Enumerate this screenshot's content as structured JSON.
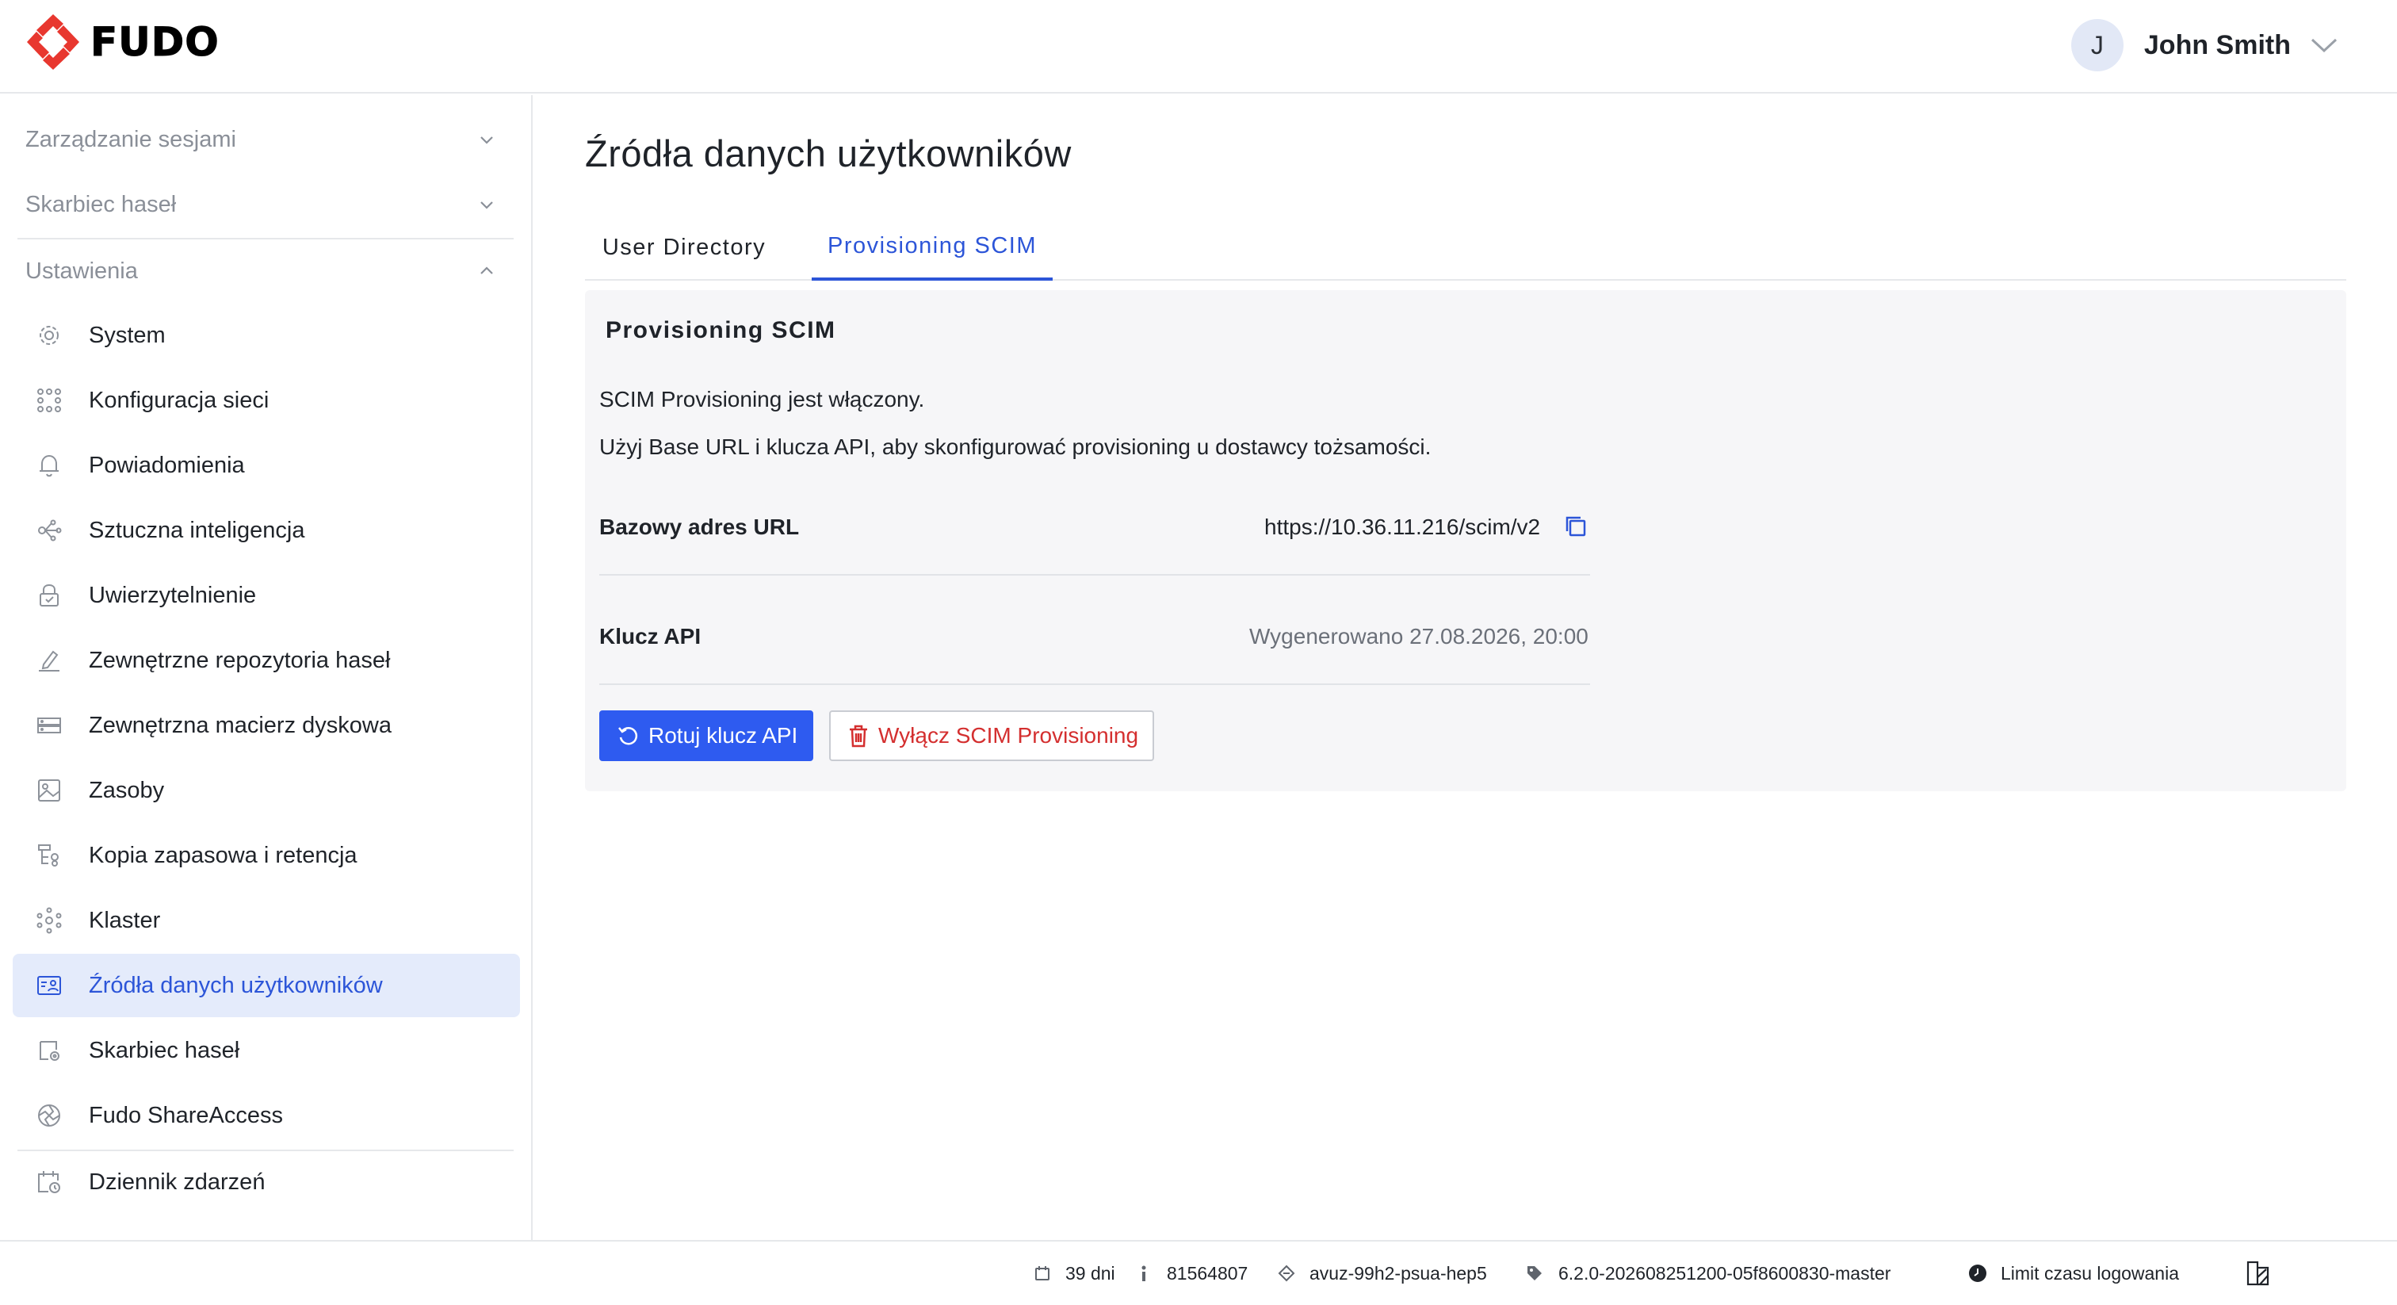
{
  "header": {
    "logo_text": "FUDO",
    "user": {
      "initial": "J",
      "name": "John Smith"
    }
  },
  "sidebar": {
    "sections": [
      {
        "label": "Zarządzanie sesjami",
        "expanded": false
      },
      {
        "label": "Skarbiec haseł",
        "expanded": false
      },
      {
        "label": "Ustawienia",
        "expanded": true
      }
    ],
    "items": [
      {
        "label": "System",
        "icon": "gear-icon"
      },
      {
        "label": "Konfiguracja sieci",
        "icon": "network-icon"
      },
      {
        "label": "Powiadomienia",
        "icon": "bell-icon"
      },
      {
        "label": "Sztuczna inteligencja",
        "icon": "ai-icon"
      },
      {
        "label": "Uwierzytelnienie",
        "icon": "lock-icon"
      },
      {
        "label": "Zewnętrzne repozytoria haseł",
        "icon": "pen-icon"
      },
      {
        "label": "Zewnętrzna macierz dyskowa",
        "icon": "storage-icon"
      },
      {
        "label": "Zasoby",
        "icon": "image-icon"
      },
      {
        "label": "Kopia zapasowa i retencja",
        "icon": "backup-icon"
      },
      {
        "label": "Klaster",
        "icon": "cluster-icon"
      },
      {
        "label": "Źródła danych użytkowników",
        "icon": "user-card-icon",
        "active": true
      },
      {
        "label": "Skarbiec haseł",
        "icon": "vault-icon"
      },
      {
        "label": "Fudo ShareAccess",
        "icon": "share-icon"
      }
    ],
    "bottom_item": {
      "label": "Dziennik zdarzeń",
      "icon": "calendar-clock-icon"
    }
  },
  "main": {
    "title": "Źródła danych użytkowników",
    "tabs": [
      {
        "label": "User Directory",
        "active": false
      },
      {
        "label": "Provisioning SCIM",
        "active": true
      }
    ],
    "panel": {
      "title": "Provisioning SCIM",
      "status_text": "SCIM Provisioning jest włączony.",
      "help_text": "Użyj Base URL i klucza API, aby skonfigurować provisioning u dostawcy tożsamości.",
      "base_url_label": "Bazowy adres URL",
      "base_url_value": "https://10.36.11.216/scim/v2",
      "api_key_label": "Klucz API",
      "api_key_value": "Wygenerowano 27.08.2026, 20:00",
      "rotate_button": "Rotuj klucz API",
      "disable_button": "Wyłącz SCIM Provisioning"
    }
  },
  "footer": {
    "days": "39 dni",
    "id": "81564807",
    "host": "avuz-99h2-psua-hep5",
    "version": "6.2.0-202608251200-05f8600830-master",
    "login_timeout": "Limit czasu logowania"
  },
  "colors": {
    "accent": "#2c55d8",
    "primary_button": "#2e5bf0",
    "danger": "#d42f2f",
    "active_nav_bg": "#e4ebfb",
    "panel_bg": "#f6f6f8",
    "logo_red": "#e8372f"
  }
}
